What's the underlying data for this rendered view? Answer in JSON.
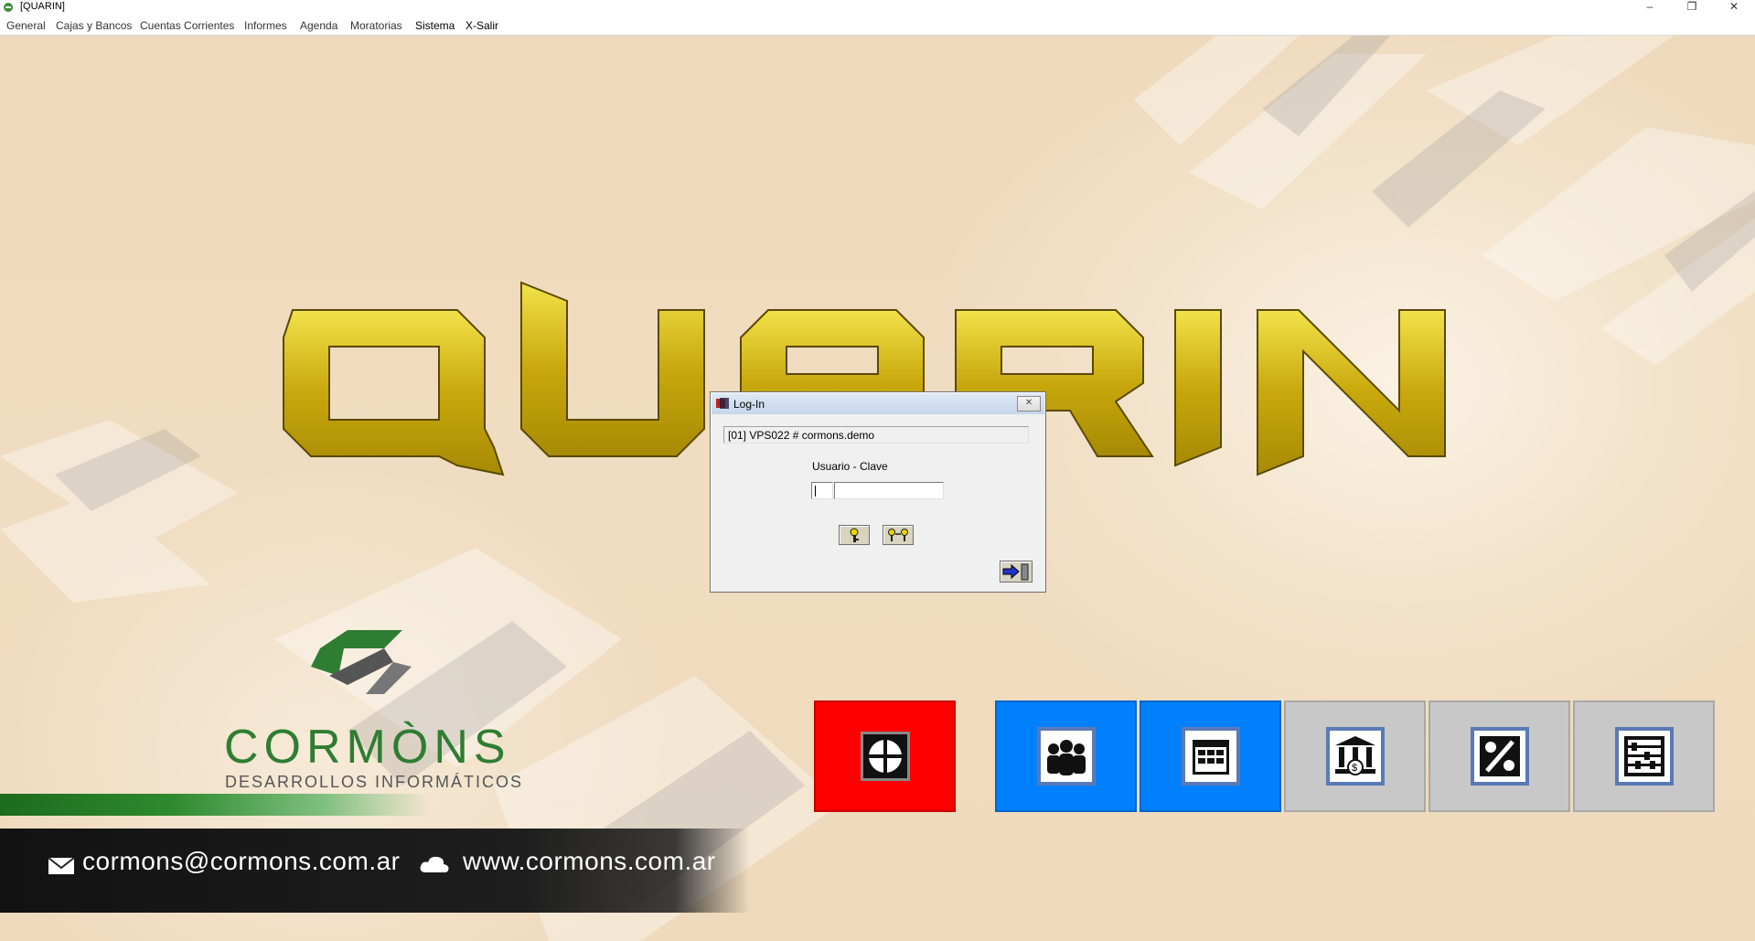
{
  "window": {
    "title": "[QUARIN]",
    "minimize_label": "–",
    "restore_label": "❐",
    "close_label": "✕"
  },
  "menu": [
    {
      "label": "General"
    },
    {
      "label": "Cajas y Bancos"
    },
    {
      "label": "Cuentas Corrientes"
    },
    {
      "label": "Informes"
    },
    {
      "label": "Agenda"
    },
    {
      "label": "Moratorias"
    },
    {
      "label": "Sistema"
    },
    {
      "label": "X-Salir"
    }
  ],
  "login": {
    "title": "Log-In",
    "database": "[01] VPS022 # cormons.demo",
    "user_label": "Usuario - Clave",
    "user_value": "",
    "password_value": ""
  },
  "branding": {
    "app_logo_text": "QUARIN",
    "company_logo_text": "CORMÒNS",
    "company_tagline": "DESARROLLOS INFORMÁTICOS",
    "email": "cormons@cormons.com.ar",
    "website": "www.cormons.com.ar"
  },
  "tiles": [
    {
      "icon": "crosshair-icon",
      "color": "#ff0000"
    },
    {
      "icon": "people-icon",
      "color": "#0080ff"
    },
    {
      "icon": "calendar-icon",
      "color": "#0080ff"
    },
    {
      "icon": "bank-icon",
      "color": "#c8c8c8"
    },
    {
      "icon": "percent-icon",
      "color": "#c8c8c8"
    },
    {
      "icon": "abacus-icon",
      "color": "#c8c8c8"
    }
  ]
}
